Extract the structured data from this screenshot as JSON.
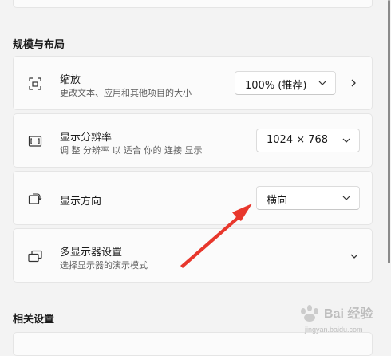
{
  "section_layout": {
    "title": "规模与布局"
  },
  "scale": {
    "title": "缩放",
    "description": "更改文本、应用和其他项目的大小",
    "value": "100% (推荐)"
  },
  "resolution": {
    "title": "显示分辨率",
    "description": "调 整 分辨率 以 适合 你的 连接 显示",
    "value": "1024 × 768"
  },
  "orientation": {
    "title": "显示方向",
    "value": "横向"
  },
  "multi_display": {
    "title": "多显示器设置",
    "description": "选择显示器的演示模式"
  },
  "section_related": {
    "title": "相关设置"
  },
  "watermark": {
    "text": "Bai 经验",
    "brand": "jingyan.baidu.com"
  },
  "colors": {
    "annotation_arrow": "#e8372c",
    "card_bg": "#fbfbfb",
    "page_bg": "#f3f3f3"
  }
}
